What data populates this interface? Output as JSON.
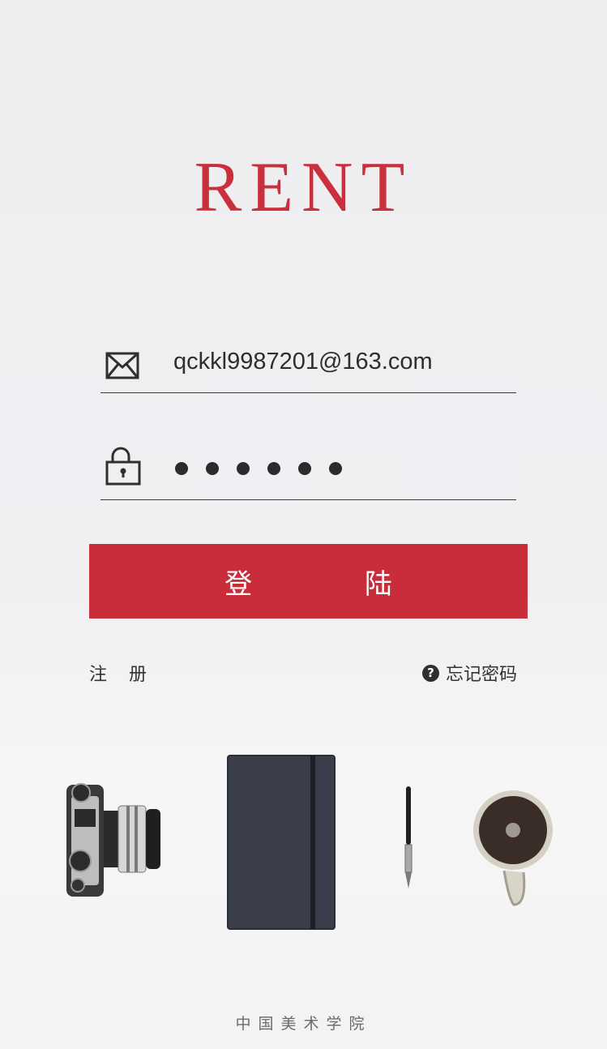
{
  "brand": {
    "logo_text": "RENT",
    "accent_color": "#c9303b"
  },
  "login_form": {
    "email": {
      "icon": "mail-icon",
      "value": "qckkl9987201@163.com"
    },
    "password": {
      "icon": "lock-icon",
      "masked_length": 6
    },
    "submit_label": "登 陆"
  },
  "links": {
    "register_label": "注 册",
    "forgot_password_label": "忘记密码",
    "forgot_password_icon": "help-icon",
    "help_glyph": "?"
  },
  "footer": {
    "text": "中国美术学院"
  }
}
